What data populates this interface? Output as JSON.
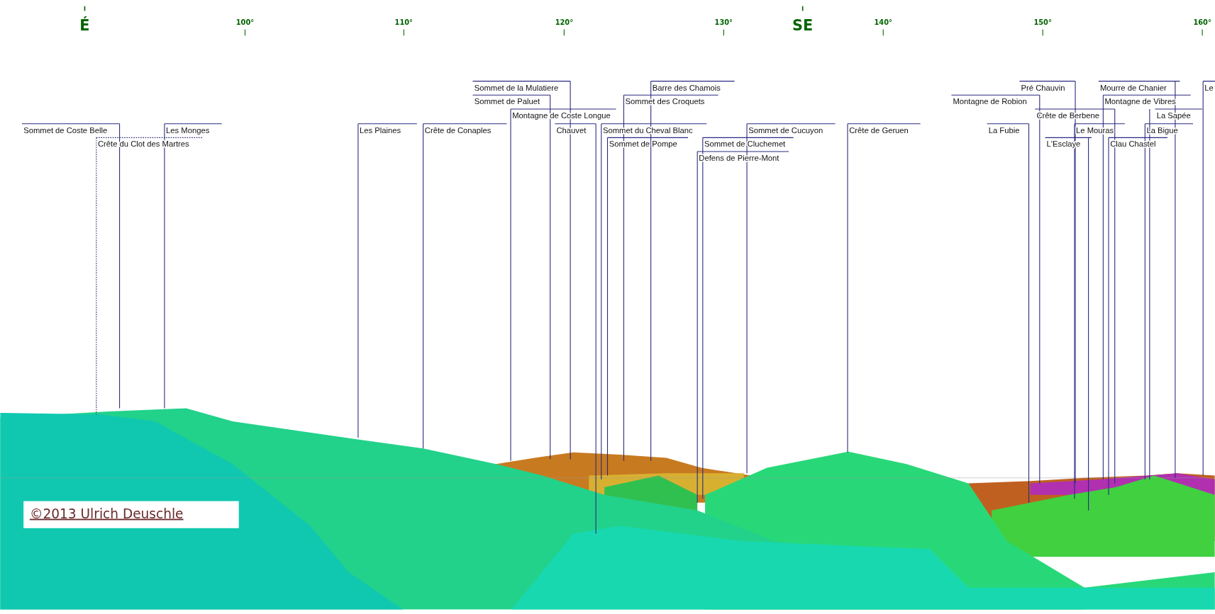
{
  "compass": {
    "ticks": [
      {
        "label": "É",
        "kind": "cardinal"
      },
      {
        "label": "100°",
        "kind": "degree"
      },
      {
        "label": "110°",
        "kind": "degree"
      },
      {
        "label": "120°",
        "kind": "degree"
      },
      {
        "label": "130°",
        "kind": "degree"
      },
      {
        "label": "SE",
        "kind": "cardinal"
      },
      {
        "label": "140°",
        "kind": "degree"
      },
      {
        "label": "150°",
        "kind": "degree"
      },
      {
        "label": "160°",
        "kind": "degree"
      }
    ]
  },
  "peaks": [
    {
      "name": "Sommet de la Mulatiere",
      "obscured": false
    },
    {
      "name": "Barre des Chamois",
      "obscured": false
    },
    {
      "name": "Pré Chauvin",
      "obscured": false
    },
    {
      "name": "Mourre de Chanier",
      "obscured": false
    },
    {
      "name": "Le",
      "obscured": false
    },
    {
      "name": "Sommet de Paluet",
      "obscured": false
    },
    {
      "name": "Sommet des Croquets",
      "obscured": false
    },
    {
      "name": "Montagne de Robion",
      "obscured": false
    },
    {
      "name": "Montagne de Vibres",
      "obscured": false
    },
    {
      "name": "Montagne de Coste Longue",
      "obscured": false
    },
    {
      "name": "Crête de Berbene",
      "obscured": false
    },
    {
      "name": "La Sapée",
      "obscured": false
    },
    {
      "name": "Sommet de Coste Belle",
      "obscured": false
    },
    {
      "name": "Les Monges",
      "obscured": false
    },
    {
      "name": "Les Plaines",
      "obscured": false
    },
    {
      "name": "Crête de Conaples",
      "obscured": false
    },
    {
      "name": "Chauvet",
      "obscured": false
    },
    {
      "name": "Sommet du Cheval Blanc",
      "obscured": false
    },
    {
      "name": "Sommet de Cucuyon",
      "obscured": false
    },
    {
      "name": "Crête de Geruen",
      "obscured": false
    },
    {
      "name": "La Fubie",
      "obscured": false
    },
    {
      "name": "Le Mouras",
      "obscured": false
    },
    {
      "name": "La Bigue",
      "obscured": false
    },
    {
      "name": "Crête du Clot des Martres",
      "obscured": true
    },
    {
      "name": "Sommet de Pompe",
      "obscured": false
    },
    {
      "name": "Sommet de Cluchemet",
      "obscured": false
    },
    {
      "name": "L'Esclaye",
      "obscured": false
    },
    {
      "name": "Clau Chastel",
      "obscured": false
    },
    {
      "name": "Defens de Pierre-Mont",
      "obscured": false
    }
  ],
  "copyright": "©2013 Ulrich Deuschle"
}
